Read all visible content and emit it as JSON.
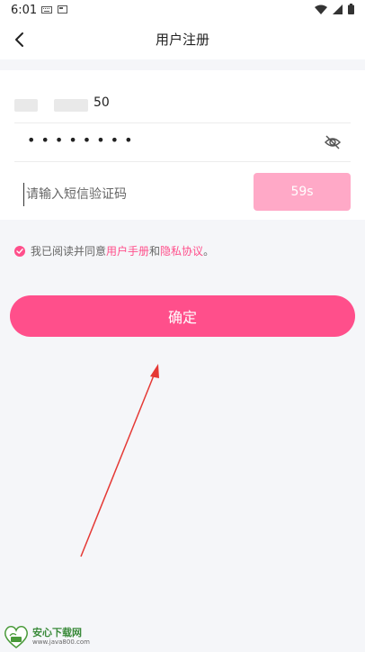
{
  "status_bar": {
    "time": "6:01"
  },
  "header": {
    "title": "用户注册",
    "back_icon": "chevron-left-icon"
  },
  "form": {
    "phone_value_visible": "50",
    "password_mask": "••••••••",
    "password_icon": "eye-off-icon",
    "code_placeholder": "请输入短信验证码",
    "code_value": "",
    "countdown_label": "59s"
  },
  "agreement": {
    "prefix": "我已阅读并同意",
    "link1": "用户手册",
    "and": "和",
    "link2": "隐私协议",
    "suffix": "。",
    "checked": true
  },
  "confirm_button": {
    "label": "确定"
  },
  "watermark": {
    "title": "安心下载网",
    "url": "www.java800.com"
  },
  "colors": {
    "accent": "#ff4f8b",
    "countdown_disabled": "#ffa9c7",
    "background": "#f5f6f9",
    "arrow": "#e53935"
  }
}
